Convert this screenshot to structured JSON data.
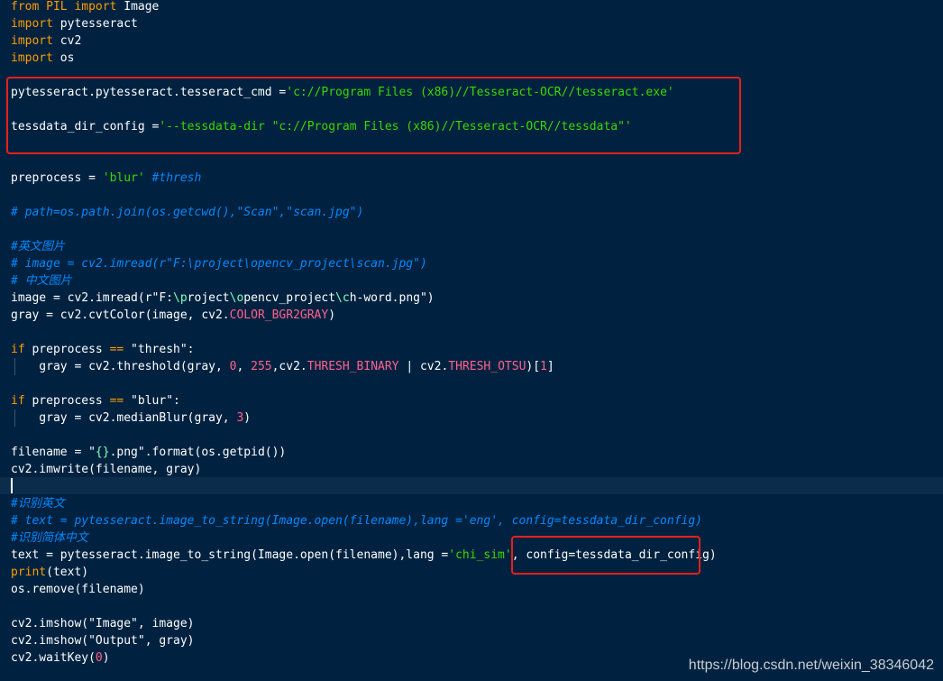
{
  "theme": {
    "background": "#002240",
    "current_line": "#0b2c4a",
    "keyword": "#ff9d00",
    "default": "#ffffff",
    "string": "#3ad900",
    "string_escape": "#80ffbb",
    "comment": "#0088ff",
    "number": "#ff628c",
    "constant": "#ff628c",
    "function": "#ffee80",
    "annotation_box": "#e8201a"
  },
  "code_lines": [
    {
      "tokens": [
        {
          "t": "from",
          "k": "keyword"
        },
        {
          "t": " ",
          "k": "default"
        },
        {
          "t": "PIL",
          "k": "keyword"
        },
        {
          "t": " ",
          "k": "default"
        },
        {
          "t": "import",
          "k": "keyword"
        },
        {
          "t": " Image",
          "k": "default"
        }
      ]
    },
    {
      "tokens": [
        {
          "t": "import",
          "k": "keyword"
        },
        {
          "t": " pytesseract",
          "k": "default"
        }
      ]
    },
    {
      "tokens": [
        {
          "t": "import",
          "k": "keyword"
        },
        {
          "t": " cv2",
          "k": "default"
        }
      ]
    },
    {
      "tokens": [
        {
          "t": "import",
          "k": "keyword"
        },
        {
          "t": " os",
          "k": "default"
        }
      ]
    },
    {
      "tokens": []
    },
    {
      "tokens": [
        {
          "t": "pytesseract.pytesseract.tesseract_cmd =",
          "k": "default"
        },
        {
          "t": "'c://Program Files (x86)//Tesseract-OCR//tesseract.exe'",
          "k": "default"
        }
      ]
    },
    {
      "tokens": []
    },
    {
      "tokens": [
        {
          "t": "tessdata_dir_config =",
          "k": "default"
        },
        {
          "t": "'--tessdata-dir \"c://Program Files (x86)//Tesseract-OCR//tessdata\"'",
          "k": "default"
        }
      ]
    },
    {
      "tokens": []
    },
    {
      "tokens": []
    },
    {
      "tokens": [
        {
          "t": "preprocess = ",
          "k": "default"
        },
        {
          "t": "'blur'",
          "k": "default"
        },
        {
          "t": " ",
          "k": "default"
        },
        {
          "t": "#thresh",
          "k": "comment"
        }
      ]
    },
    {
      "tokens": []
    },
    {
      "tokens": [
        {
          "t": "# path=os.path.join(os.getcwd(),\"Scan\",\"scan.jpg\")",
          "k": "comment"
        }
      ]
    },
    {
      "tokens": []
    },
    {
      "tokens": [
        {
          "t": "#英文图片",
          "k": "comment"
        }
      ]
    },
    {
      "tokens": [
        {
          "t": "# image = cv2.imread(r\"F:\\project\\opencv_project\\scan.jpg\")",
          "k": "comment"
        }
      ]
    },
    {
      "tokens": [
        {
          "t": "# 中文图片",
          "k": "comment"
        }
      ]
    },
    {
      "tokens": [
        {
          "t": "image = cv2.imread(r\"F:",
          "k": "default"
        },
        {
          "t": "\\p",
          "k": "string_escape"
        },
        {
          "t": "roject",
          "k": "default"
        },
        {
          "t": "\\o",
          "k": "string_escape"
        },
        {
          "t": "pencv_project",
          "k": "default"
        },
        {
          "t": "\\c",
          "k": "string_escape"
        },
        {
          "t": "h-word.png\")",
          "k": "default"
        }
      ]
    },
    {
      "tokens": [
        {
          "t": "gray = cv2.cvtColor(image, cv2.",
          "k": "default"
        },
        {
          "t": "COLOR_BGR2GRAY",
          "k": "constant"
        },
        {
          "t": ")",
          "k": "default"
        }
      ]
    },
    {
      "tokens": []
    },
    {
      "tokens": [
        {
          "t": "if",
          "k": "keyword"
        },
        {
          "t": " preprocess ",
          "k": "default"
        },
        {
          "t": "==",
          "k": "keyword"
        },
        {
          "t": " \"thresh\":",
          "k": "default"
        }
      ]
    },
    {
      "tokens": [
        {
          "t": "    gray = cv2.threshold(gray, ",
          "k": "default"
        },
        {
          "t": "0",
          "k": "number"
        },
        {
          "t": ", ",
          "k": "default"
        },
        {
          "t": "255",
          "k": "number"
        },
        {
          "t": ",cv2.",
          "k": "default"
        },
        {
          "t": "THRESH_BINARY",
          "k": "constant"
        },
        {
          "t": " | cv2.",
          "k": "default"
        },
        {
          "t": "THRESH_OTSU",
          "k": "constant"
        },
        {
          "t": ")[",
          "k": "default"
        },
        {
          "t": "1",
          "k": "number"
        },
        {
          "t": "]",
          "k": "default"
        }
      ],
      "indent": true
    },
    {
      "tokens": []
    },
    {
      "tokens": [
        {
          "t": "if",
          "k": "keyword"
        },
        {
          "t": " preprocess ",
          "k": "default"
        },
        {
          "t": "==",
          "k": "keyword"
        },
        {
          "t": " \"blur\":",
          "k": "default"
        }
      ]
    },
    {
      "tokens": [
        {
          "t": "    gray = cv2.medianBlur(gray, ",
          "k": "default"
        },
        {
          "t": "3",
          "k": "number"
        },
        {
          "t": ")",
          "k": "default"
        }
      ],
      "indent": true
    },
    {
      "tokens": []
    },
    {
      "tokens": [
        {
          "t": "filename = \"",
          "k": "default"
        },
        {
          "t": "{}",
          "k": "string_escape"
        },
        {
          "t": ".png\".format(os.getpid())",
          "k": "default"
        }
      ]
    },
    {
      "tokens": [
        {
          "t": "cv2.imwrite(filename, gray)",
          "k": "default"
        }
      ]
    },
    {
      "tokens": []
    },
    {
      "tokens": [
        {
          "t": "#识别英文",
          "k": "comment"
        }
      ]
    },
    {
      "tokens": [
        {
          "t": "# text = pytesseract.image_to_string(Image.open(filename),lang ='eng', config=tessdata_dir_config)",
          "k": "comment"
        }
      ]
    },
    {
      "tokens": [
        {
          "t": "#识别简体中文",
          "k": "comment"
        }
      ]
    },
    {
      "tokens": [
        {
          "t": "text = pytesseract.image_to_string(Image.open(filename),lang =",
          "k": "default"
        },
        {
          "t": "'chi_sim'",
          "k": "default"
        },
        {
          "t": ", config=tessdata_dir_config)",
          "k": "default"
        }
      ]
    },
    {
      "tokens": [
        {
          "t": "print",
          "k": "keyword"
        },
        {
          "t": "(text)",
          "k": "default"
        }
      ]
    },
    {
      "tokens": [
        {
          "t": "os.remove(filename)",
          "k": "default"
        }
      ]
    },
    {
      "tokens": []
    },
    {
      "tokens": [
        {
          "t": "cv2.imshow(\"Image\", image)",
          "k": "default"
        }
      ]
    },
    {
      "tokens": [
        {
          "t": "cv2.imshow(\"Output\", gray)",
          "k": "default"
        }
      ]
    },
    {
      "tokens": [
        {
          "t": "cv2.waitKey(",
          "k": "default"
        },
        {
          "t": "0",
          "k": "number"
        },
        {
          "t": ")",
          "k": "default"
        }
      ]
    }
  ],
  "watermark": "https://blog.csdn.net/weixin_38346042"
}
